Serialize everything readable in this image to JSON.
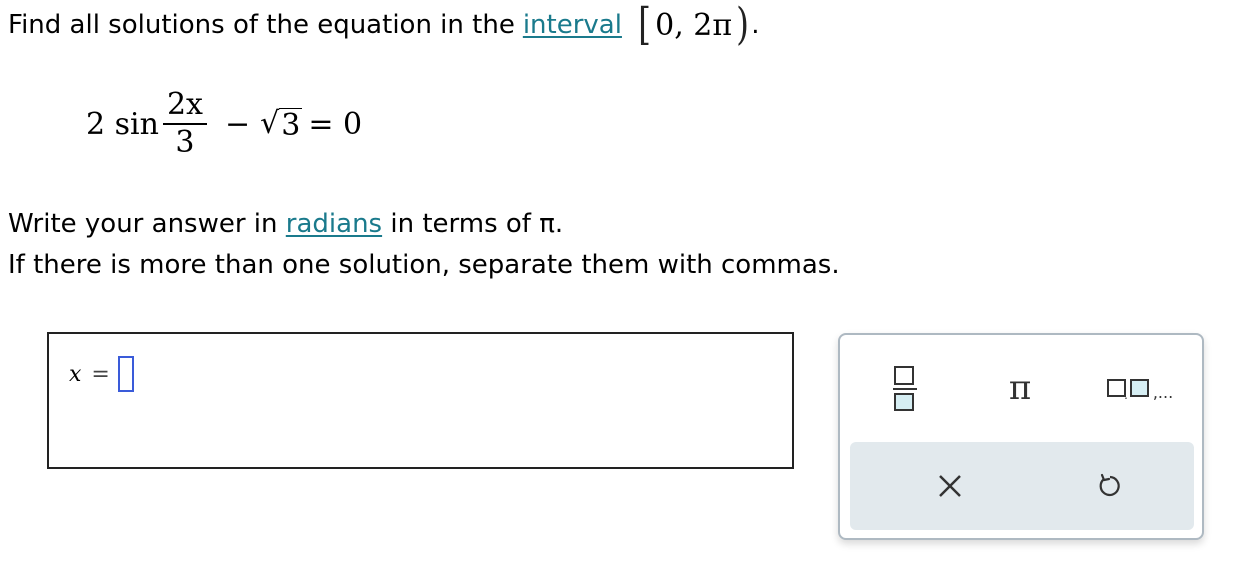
{
  "question": {
    "prompt_prefix": "Find all solutions of the equation in the",
    "interval_link": "interval",
    "interval_open": "[",
    "interval_value": "0, 2π",
    "interval_close": ")",
    "interval_period": "."
  },
  "equation": {
    "coefficient": "2 sin",
    "fraction_numerator": "2x",
    "fraction_denominator": "3",
    "minus": "−",
    "radical_symbol": "√",
    "radicand": "3",
    "rest": "= 0"
  },
  "instructions": {
    "line1_prefix": "Write your answer in",
    "line1_link": "radians",
    "line1_suffix": "in terms of π.",
    "line2": "If there is more than one solution, separate them with commas."
  },
  "answer": {
    "variable": "x",
    "equals": "=",
    "value": ""
  },
  "keypad": {
    "pi_label": "π",
    "list_ellipsis": ",...",
    "icons": [
      "fraction-icon",
      "pi-icon",
      "list-icon",
      "close-icon",
      "undo-icon"
    ],
    "colors": {
      "border": "#aeb9c2",
      "row_background": "#e2e9ed",
      "icon": "#333333",
      "link": "#1a7a8c",
      "input_border": "#3a5bd9"
    }
  }
}
